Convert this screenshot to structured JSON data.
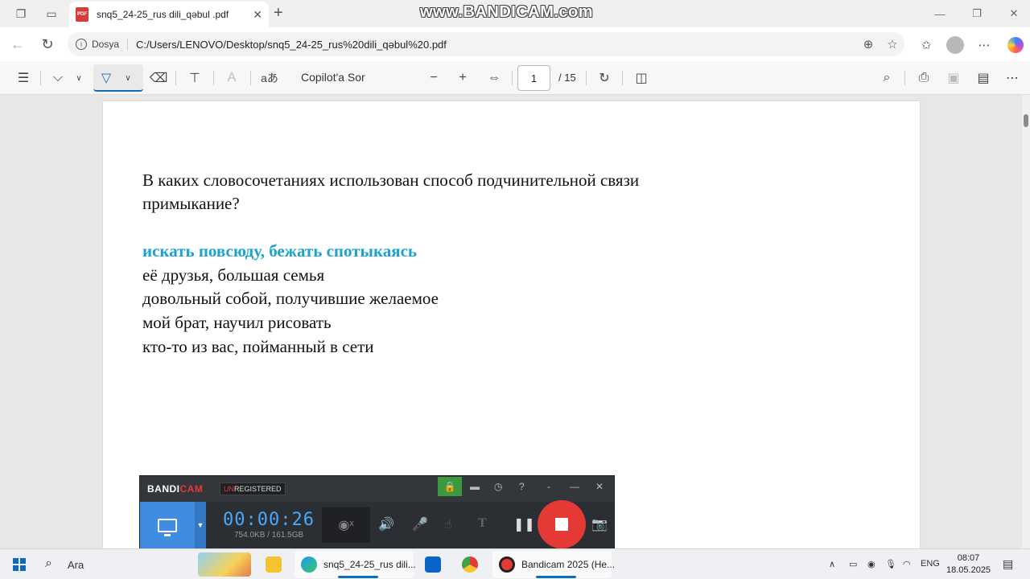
{
  "browser": {
    "tab_title": "snq5_24-25_rus dili_qəbul .pdf",
    "pdf_badge": "PDF",
    "watermark": "www.BANDICAM.com",
    "address_label": "Dosya",
    "url": "C:/Users/LENOVO/Desktop/snq5_24-25_rus%20dili_qəbul%20.pdf"
  },
  "pdf_toolbar": {
    "read_aloud_glyph": "aあ",
    "copilot_label": "Copilot'a Sor",
    "page_current": "1",
    "page_total": "/ 15"
  },
  "document": {
    "question_line1": "В каких словосочетаниях использован способ подчинительной связи",
    "question_line2": "примыкание?",
    "options": [
      "искать повсюду, бежать спотыкаясь",
      "её друзья, большая семья",
      "довольный собой, получившие желаемое",
      "мой брат, научил рисовать",
      "кто-то из вас, пойманный в сети"
    ],
    "answer_color": "#1aa3d1"
  },
  "bandicam": {
    "logo_a": "BANDI",
    "logo_b": "CAM",
    "unregistered_a": "UN",
    "unregistered_b": "REGISTERED",
    "timer": "00:00:26",
    "size": "754.0KB / 161.5GB"
  },
  "taskbar": {
    "search_label": "Ara",
    "apps": [
      {
        "label": "snq5_24-25_rus dili..."
      },
      {
        "label": "Bandicam 2025 (He..."
      }
    ],
    "language": "ENG",
    "time": "08:07",
    "date": "18.05.2025"
  }
}
